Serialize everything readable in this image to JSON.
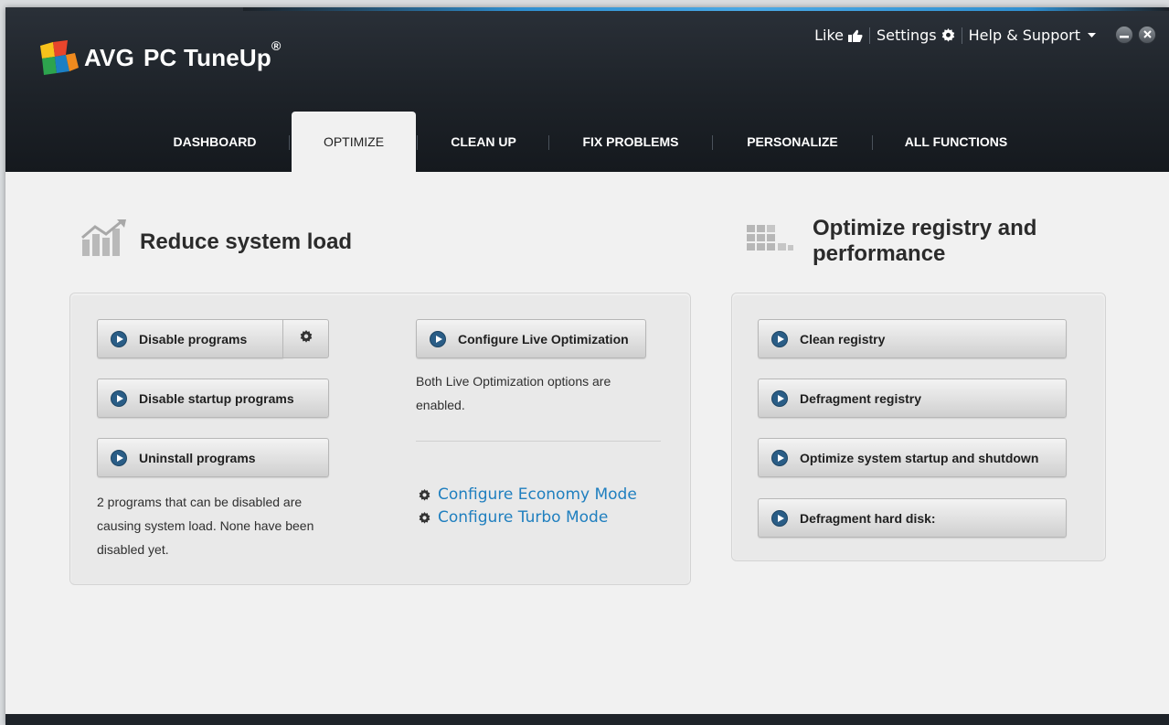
{
  "app": {
    "brand": "AVG",
    "product": "PC TuneUp",
    "registered_mark": "®"
  },
  "top_links": {
    "like": "Like",
    "settings": "Settings",
    "help": "Help & Support"
  },
  "nav": {
    "tabs": [
      {
        "label": "DASHBOARD"
      },
      {
        "label": "OPTIMIZE"
      },
      {
        "label": "CLEAN UP"
      },
      {
        "label": "FIX PROBLEMS"
      },
      {
        "label": "PERSONALIZE"
      },
      {
        "label": "ALL FUNCTIONS"
      }
    ],
    "active": "OPTIMIZE"
  },
  "reduce": {
    "title": "Reduce system load",
    "buttons": {
      "disable_programs": "Disable programs",
      "disable_startup": "Disable startup programs",
      "uninstall": "Uninstall programs",
      "configure_live": "Configure Live Optimization"
    },
    "status": "2 programs that can be disabled are causing system load. None have been disabled yet.",
    "live_status": "Both Live Optimization options are enabled.",
    "economy_link": "Configure Economy Mode",
    "turbo_link": "Configure Turbo Mode"
  },
  "registry": {
    "title": "Optimize registry and performance",
    "buttons": {
      "clean": "Clean registry",
      "defrag_registry": "Defragment registry",
      "startup_shutdown": "Optimize system startup and shutdown",
      "defrag_disk": "Defragment hard disk:"
    }
  },
  "colors": {
    "accent_blue": "#2f8fd0",
    "link_blue": "#1f7fbf",
    "play_blue": "#2a5d86",
    "header_dark": "#1d2228"
  },
  "icons": [
    "avg-logo-icon",
    "thumbs-up-icon",
    "gear-icon",
    "chevron-down-icon",
    "minimize-icon",
    "close-icon",
    "chart-icon",
    "registry-blocks-icon",
    "play-icon"
  ]
}
